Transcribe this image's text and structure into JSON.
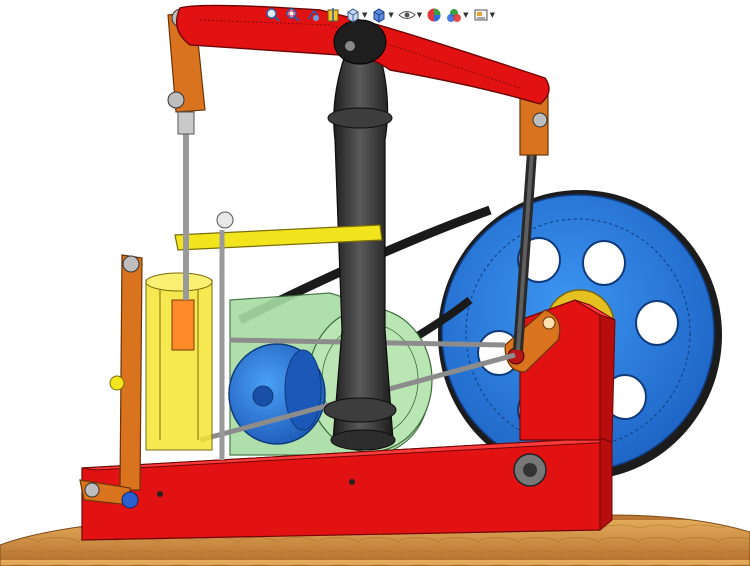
{
  "app": {
    "heads_up_toolbar": [
      {
        "icon": "zoom-to-fit-icon",
        "has_dropdown": false
      },
      {
        "icon": "zoom-to-area-icon",
        "has_dropdown": false
      },
      {
        "icon": "previous-view-icon",
        "has_dropdown": false
      },
      {
        "icon": "section-view-icon",
        "has_dropdown": false
      },
      {
        "icon": "view-orientation-icon",
        "has_dropdown": true
      },
      {
        "icon": "display-style-icon",
        "has_dropdown": true
      },
      {
        "icon": "hide-show-items-icon",
        "has_dropdown": true
      },
      {
        "icon": "edit-appearance-icon",
        "has_dropdown": false
      },
      {
        "icon": "apply-scene-icon",
        "has_dropdown": true
      },
      {
        "icon": "view-settings-icon",
        "has_dropdown": true
      }
    ]
  },
  "model": {
    "name": "",
    "colors": {
      "beam": "#e21212",
      "base": "#e21212",
      "column": "#3a3a3a",
      "flywheel": "#2a7ee6",
      "flywheel_rim": "#1c1c1c",
      "links": "#d9731d",
      "rods": "#8c8c8c",
      "cylinder": "#f2e51e",
      "guide_bar": "#f2e51e",
      "governor_case": "#9fd3a0",
      "pulley": "#2a7ee6",
      "wood_base": "#c98a3c"
    }
  }
}
